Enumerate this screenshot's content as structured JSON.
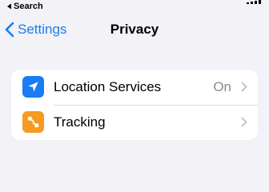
{
  "status_bar": {
    "back_app_label": "Search",
    "back_app_icon": "small-back-triangle-icon"
  },
  "nav": {
    "back_label": "Settings",
    "back_icon": "chevron-left-icon",
    "title": "Privacy"
  },
  "rows": [
    {
      "label": "Location Services",
      "value": "On",
      "icon": "location-arrow-icon",
      "icon_color": "#1a7cf4"
    },
    {
      "label": "Tracking",
      "value": "",
      "icon": "tracking-icon",
      "icon_color": "#f79a20"
    }
  ],
  "colors": {
    "background": "#f2f2f7",
    "accent": "#1a7cf4",
    "secondary_text": "#8a8a8e",
    "chevron": "#c4c4c7"
  }
}
